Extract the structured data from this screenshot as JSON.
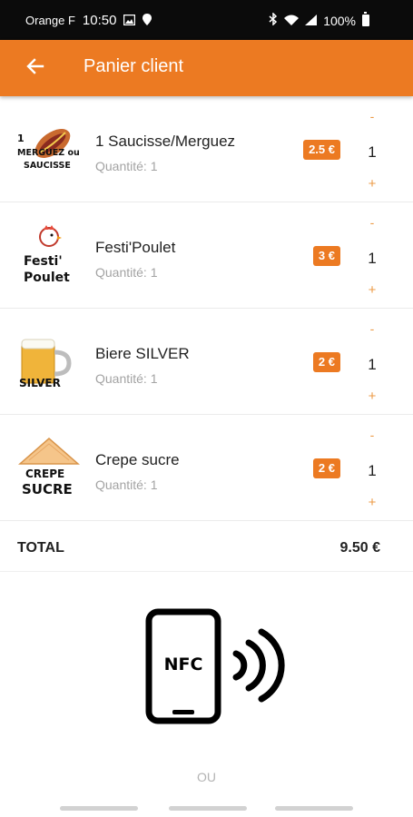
{
  "status_bar": {
    "carrier": "Orange F",
    "time": "10:50",
    "battery": "100%"
  },
  "app_bar": {
    "title": "Panier client"
  },
  "cart": {
    "items": [
      {
        "name": "1 Saucisse/Merguez",
        "quantity_label": "Quantité: 1",
        "price": "2.5 €",
        "quantity": "1",
        "thumb_text": [
          "1",
          "MERGUEZ ou",
          "SAUCISSE"
        ],
        "icon": "hotdog-icon"
      },
      {
        "name": "Festi'Poulet",
        "quantity_label": "Quantité: 1",
        "price": "3 €",
        "quantity": "1",
        "thumb_text": [
          "Festi'",
          "Poulet"
        ],
        "icon": "chicken-icon"
      },
      {
        "name": "Biere SILVER",
        "quantity_label": "Quantité: 1",
        "price": "2 €",
        "quantity": "1",
        "thumb_text": [
          "SILVER"
        ],
        "icon": "beer-mug-icon"
      },
      {
        "name": "Crepe sucre",
        "quantity_label": "Quantité: 1",
        "price": "2 €",
        "quantity": "1",
        "thumb_text": [
          "CREPE",
          "SUCRE"
        ],
        "icon": "crepe-icon"
      }
    ],
    "minus_label": "-",
    "plus_label": "+"
  },
  "total": {
    "label": "TOTAL",
    "value": "9.50 €"
  },
  "nfc": {
    "label": "NFC"
  },
  "or_label": "OU",
  "colors": {
    "accent": "#ec7a22",
    "status_bar": "#0b0b0b",
    "muted_text": "#a3a3a3"
  }
}
